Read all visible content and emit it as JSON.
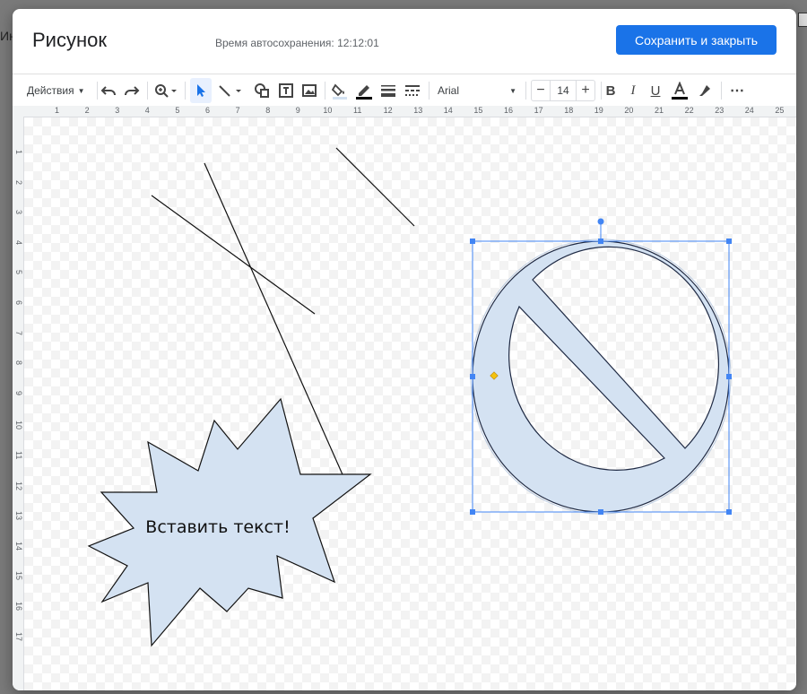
{
  "background": {
    "left_text": "Ин"
  },
  "dialog": {
    "title": "Рисунок",
    "autosave": "Время автосохранения: 12:12:01",
    "save_button": "Сохранить и закрыть"
  },
  "toolbar": {
    "actions_label": "Действия",
    "font_name": "Arial",
    "font_size": "14",
    "icons": [
      "undo-icon",
      "redo-icon",
      "zoom-icon",
      "select-icon",
      "line-icon",
      "shape-icon",
      "textbox-icon",
      "image-icon",
      "fill-color-icon",
      "border-color-icon",
      "border-weight-icon",
      "border-dash-icon",
      "bold-icon",
      "italic-icon",
      "underline-icon",
      "text-color-icon",
      "highlight-icon",
      "more-icon"
    ],
    "accent_color": "#1a73e8"
  },
  "rulers": {
    "top": [
      "1",
      "2",
      "3",
      "4",
      "5",
      "6",
      "7",
      "8",
      "9",
      "10",
      "11",
      "12",
      "13",
      "14",
      "15",
      "16",
      "17",
      "18",
      "19",
      "20",
      "21",
      "22",
      "23",
      "24",
      "25"
    ],
    "left": [
      "1",
      "2",
      "3",
      "4",
      "5",
      "6",
      "7",
      "8",
      "9",
      "10",
      "11",
      "12",
      "13",
      "14",
      "15",
      "16",
      "17"
    ]
  },
  "canvas": {
    "star_text": "Вставить текст!",
    "shape_fill": "#d4e2f2",
    "selection_color": "#4285f4",
    "adjust_handle_color": "#f4c20d"
  }
}
